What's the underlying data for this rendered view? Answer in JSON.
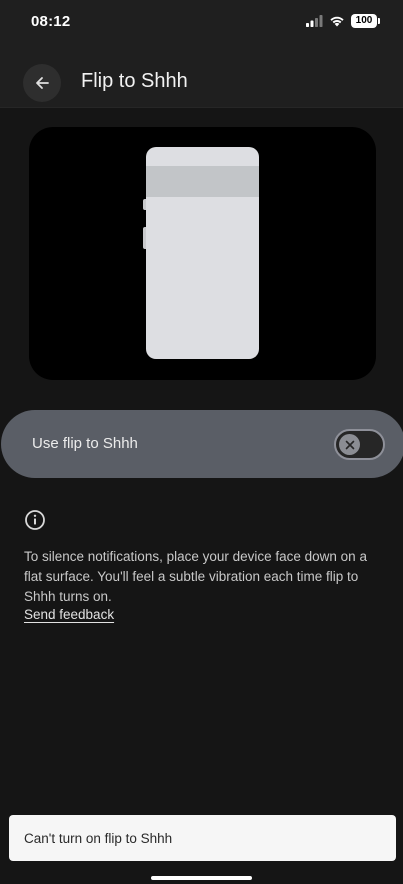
{
  "status_bar": {
    "time": "08:12",
    "battery": "100",
    "icons": [
      "signal-icon",
      "wifi-icon",
      "battery-icon"
    ]
  },
  "header": {
    "back_icon": "arrow-back-icon",
    "title": "Flip to Shhh"
  },
  "illustration": {
    "icon": "phone-illustration"
  },
  "toggle": {
    "label": "Use flip to Shhh",
    "state": "off",
    "thumb_icon": "close-icon"
  },
  "info": {
    "icon": "info-icon",
    "description": "To silence notifications, place your device face down on a flat surface. You'll feel a subtle vibration each time flip to Shhh turns on.",
    "feedback_link": "Send feedback"
  },
  "snackbar": {
    "message": "Can't turn on flip to Shhh"
  },
  "colors": {
    "background": "#151515",
    "toggle_row": "#5a5e66",
    "snackbar": "#f6f6f6"
  }
}
